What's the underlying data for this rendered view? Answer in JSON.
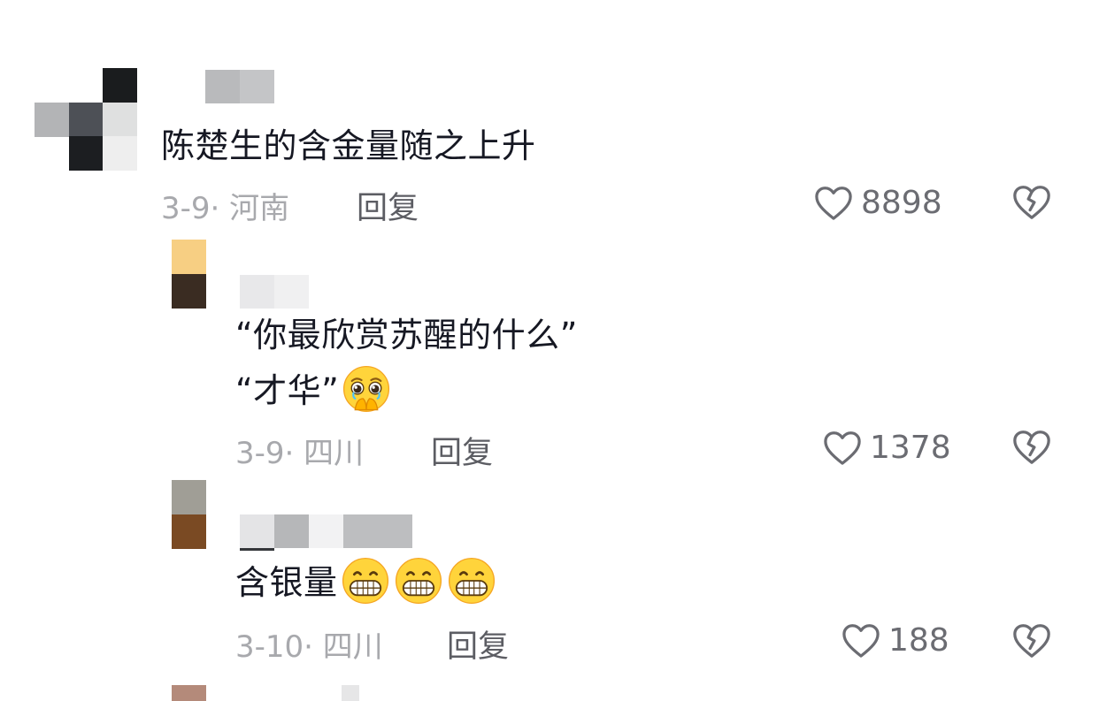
{
  "comments": [
    {
      "text": "陈楚生的含金量随之上升",
      "date": "3-9",
      "location": "河南",
      "meta": "3-9· 河南",
      "reply_label": "回复",
      "likes": "8898"
    },
    {
      "text_line1": "“你最欣赏苏醒的什么”",
      "text_line2": "“才华”",
      "emoji": [
        "pleading-hands-over-mouth"
      ],
      "date": "3-9",
      "location": "四川",
      "meta": "3-9· 四川",
      "reply_label": "回复",
      "likes": "1378"
    },
    {
      "text": "含银量",
      "emoji": [
        "grinning-face",
        "grinning-face",
        "grinning-face"
      ],
      "date": "3-10",
      "location": "四川",
      "meta": "3-10· 四川",
      "reply_label": "回复",
      "likes": "188"
    }
  ],
  "icons": {
    "like": "heart-outline-icon",
    "dislike": "broken-heart-icon"
  },
  "colors": {
    "text": "#161823",
    "meta": "#a8a9ad",
    "reply": "#5c5d63",
    "count": "#6b6c72"
  }
}
